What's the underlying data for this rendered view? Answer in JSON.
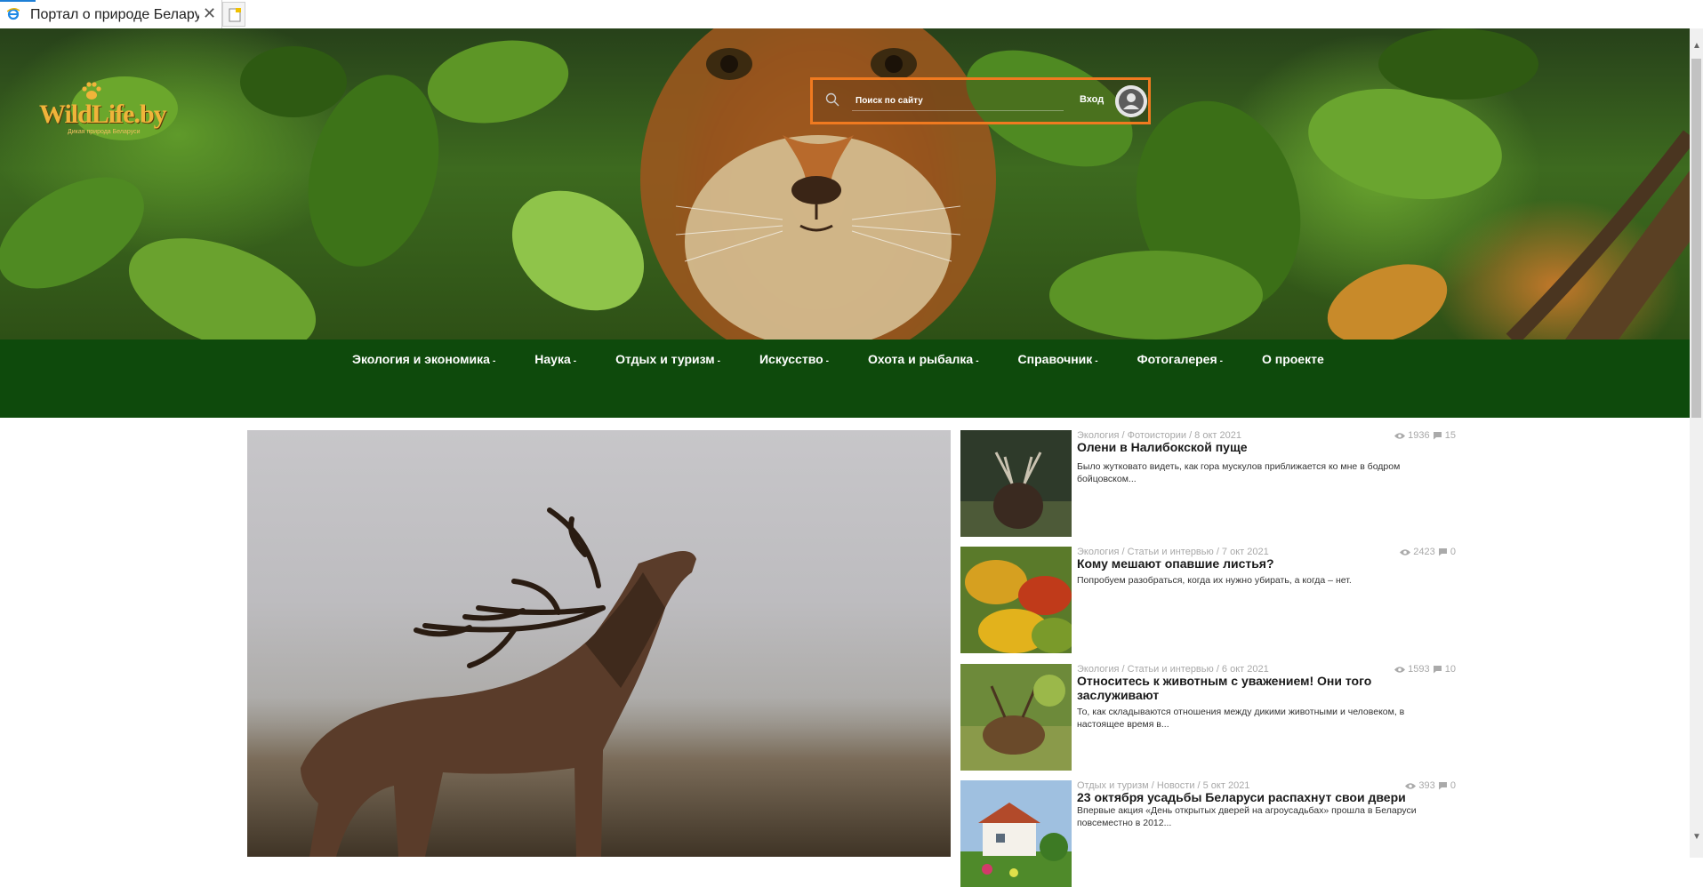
{
  "browser": {
    "tab_title": "Портал о природе Беларуси",
    "tab_icon": "ie-icon",
    "close_glyph": "✕"
  },
  "site": {
    "logo_text": "WildLife.by",
    "logo_tagline": "Дикая природа Беларуси",
    "accent_color": "#f07a20",
    "nav_color": "#0e4a0c"
  },
  "header": {
    "search_placeholder": "Поиск по сайту",
    "login_label": "Вход"
  },
  "nav": {
    "items": [
      {
        "label": "Экология и экономика",
        "has_dropdown": true
      },
      {
        "label": "Наука",
        "has_dropdown": true
      },
      {
        "label": "Отдых и туризм",
        "has_dropdown": true
      },
      {
        "label": "Искусство",
        "has_dropdown": true
      },
      {
        "label": "Охота и рыбалка",
        "has_dropdown": true
      },
      {
        "label": "Справочник",
        "has_dropdown": true
      },
      {
        "label": "Фотогалерея",
        "has_dropdown": true
      },
      {
        "label": "О проекте",
        "has_dropdown": false
      }
    ],
    "caret": "-"
  },
  "news": [
    {
      "meta": "Экология / Фотоистории / 8 окт 2021",
      "views": "1936",
      "comments": "15",
      "title": "Олени в Налибокской пуще",
      "excerpt": "Было жутковато видеть, как гора мускулов приближается ко мне в бодром бойцовском..."
    },
    {
      "meta": "Экология / Статьи и интервью / 7 окт 2021",
      "views": "2423",
      "comments": "0",
      "title": "Кому мешают опавшие листья?",
      "excerpt": "Попробуем разобраться, когда их нужно убирать, а когда – нет."
    },
    {
      "meta": "Экология / Статьи и интервью / 6 окт 2021",
      "views": "1593",
      "comments": "10",
      "title": "Относитесь к животным с уважением! Они того заслуживают",
      "excerpt": "То, как складываются отношения между дикими животными и человеком, в настоящее время в..."
    },
    {
      "meta": "Отдых и туризм / Новости / 5 окт 2021",
      "views": "393",
      "comments": "0",
      "title": "23 октября усадьбы Беларуси распахнут свои двери",
      "excerpt": "Впервые акция «День открытых дверей на агроусадьбах» прошла в Беларуси повсеместно в 2012..."
    }
  ]
}
